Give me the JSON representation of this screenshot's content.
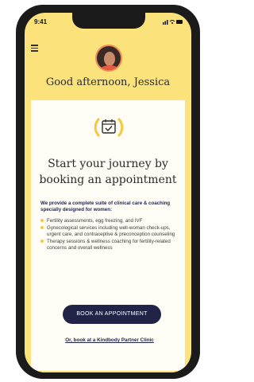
{
  "status_bar": {
    "time": "9:41",
    "indicators": "signal wifi battery"
  },
  "header": {
    "greeting": "Good afternoon, Jessica"
  },
  "card": {
    "icon": "calendar-check-icon",
    "title_line1": "Start your journey by",
    "title_line2": "booking an appointment",
    "intro": "We provide a complete suite of clinical care & coaching specially designed for women:",
    "bullets": [
      "Fertility assessments, egg freezing, and IVF",
      "Gynecological services including well-woman check-ups, urgent care, and contraceptive & preconception counseling",
      "Therapy sessions & wellness coaching for fertility-related concerns and overall wellness"
    ],
    "cta_label": "BOOK AN APPOINTMENT",
    "alt_link": "Or, book at a Kindbody Partner Clinic"
  },
  "colors": {
    "accent": "#fbe27a",
    "button": "#222447",
    "avatar_ring": "#f08a56"
  }
}
